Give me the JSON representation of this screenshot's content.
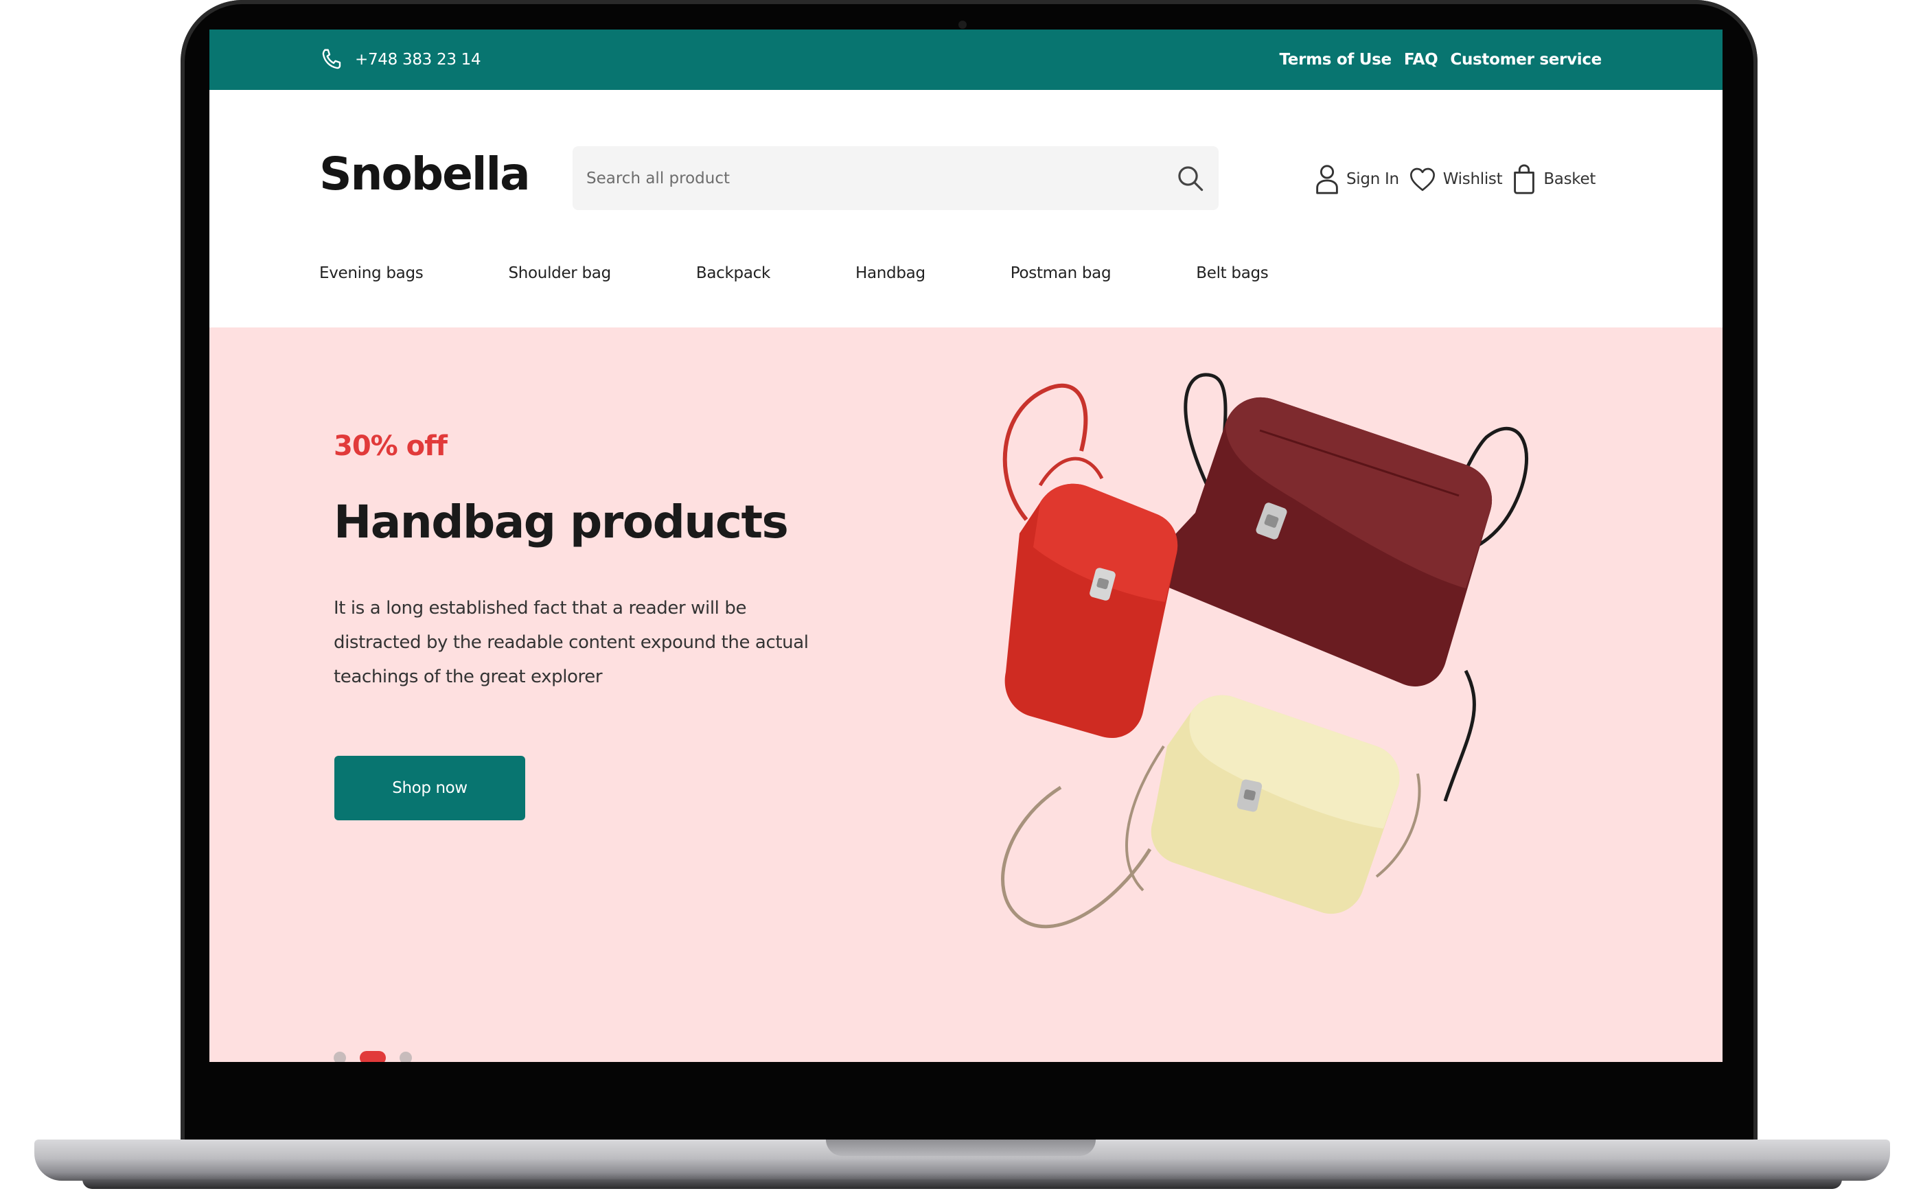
{
  "topbar": {
    "phone": "+748 383 23 14",
    "links": [
      "Terms of Use",
      "FAQ",
      "Customer service"
    ]
  },
  "header": {
    "logo": "Snobella",
    "search": {
      "placeholder": "Search all product",
      "value": ""
    },
    "actions": {
      "sign_in": "Sign In",
      "wishlist": "Wishlist",
      "basket": "Basket"
    }
  },
  "nav": {
    "categories": [
      "Evening bags",
      "Shoulder bag",
      "Backpack",
      "Handbag",
      "Postman bag",
      "Belt bags"
    ]
  },
  "hero": {
    "discount": "30% off",
    "title": "Handbag products",
    "description": "It is a long established fact that a reader will be distracted by the readable content expound the actual teachings of the great explorer",
    "cta": "Shop now",
    "carousel": {
      "slides": 3,
      "active": 2
    }
  },
  "icons": {
    "phone": "phone-icon",
    "search": "search-icon",
    "user": "user-icon",
    "wishlist": "heart-icon",
    "basket": "shopping-bag-icon"
  },
  "colors": {
    "brand": "#087570",
    "accent": "#e13a3a",
    "hero_background": "#fee0e0",
    "bag_red": "#d92a22",
    "bag_burgundy": "#6e1e22",
    "bag_cream": "#f1e9b4"
  }
}
